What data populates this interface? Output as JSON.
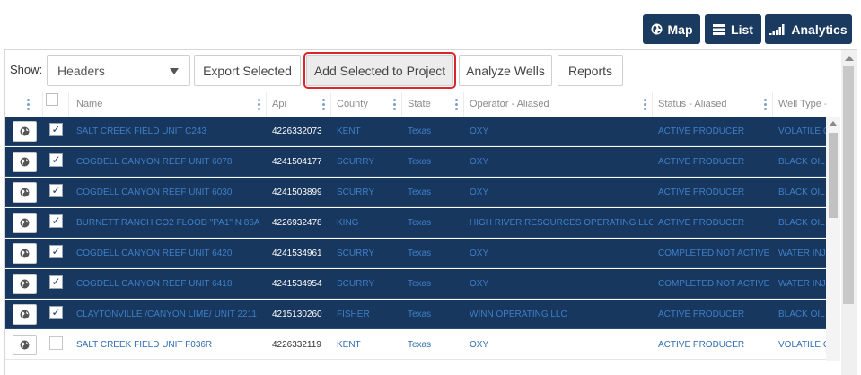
{
  "views": {
    "map": {
      "label": "Map",
      "icon": "globe-icon"
    },
    "list": {
      "label": "List",
      "icon": "list-icon"
    },
    "analytics": {
      "label": "Analytics",
      "icon": "bar-chart-icon"
    }
  },
  "toolbar": {
    "show_label": "Show:",
    "show_select_value": "Headers",
    "export_selected": "Export Selected",
    "add_selected_to_project": "Add Selected to Project",
    "analyze_wells": "Analyze Wells",
    "reports": "Reports"
  },
  "columns": {
    "name": "Name",
    "api": "Api",
    "county": "County",
    "state": "State",
    "operator": "Operator - Aliased",
    "status": "Status - Aliased",
    "well_type": "Well Type - Aliased"
  },
  "rows": [
    {
      "selected": true,
      "check": "✓",
      "name": "SALT CREEK FIELD UNIT C243",
      "api": "4226332073",
      "county": "KENT",
      "state": "Texas",
      "operator": "OXY",
      "status": "ACTIVE PRODUCER",
      "well_type": "VOLATILE OIL"
    },
    {
      "selected": true,
      "check": "✓",
      "name": "COGDELL CANYON REEF UNIT 6078",
      "api": "4241504177",
      "county": "SCURRY",
      "state": "Texas",
      "operator": "OXY",
      "status": "ACTIVE PRODUCER",
      "well_type": "BLACK OIL"
    },
    {
      "selected": true,
      "check": "✓",
      "name": "COGDELL CANYON REEF UNIT 6030",
      "api": "4241503899",
      "county": "SCURRY",
      "state": "Texas",
      "operator": "OXY",
      "status": "ACTIVE PRODUCER",
      "well_type": "BLACK OIL"
    },
    {
      "selected": true,
      "check": "✓",
      "name": "BURNETT RANCH CO2 FLOOD \"PA1\" N 86A",
      "api": "4226932478",
      "county": "KING",
      "state": "Texas",
      "operator": "HIGH RIVER RESOURCES OPERATING LLC",
      "status": "ACTIVE PRODUCER",
      "well_type": "BLACK OIL"
    },
    {
      "selected": true,
      "check": "✓",
      "name": "COGDELL CANYON REEF UNIT 6420",
      "api": "4241534961",
      "county": "SCURRY",
      "state": "Texas",
      "operator": "OXY",
      "status": "COMPLETED NOT ACTIVE",
      "well_type": "WATER INJECTOR"
    },
    {
      "selected": true,
      "check": "✓",
      "name": "COGDELL CANYON REEF UNIT 6418",
      "api": "4241534954",
      "county": "SCURRY",
      "state": "Texas",
      "operator": "OXY",
      "status": "COMPLETED NOT ACTIVE",
      "well_type": "WATER INJECTOR"
    },
    {
      "selected": true,
      "check": "✓",
      "name": "CLAYTONVILLE /CANYON LIME/ UNIT 2211",
      "api": "4215130260",
      "county": "FISHER",
      "state": "Texas",
      "operator": "WINN OPERATING LLC",
      "status": "ACTIVE PRODUCER",
      "well_type": "BLACK OIL"
    },
    {
      "selected": false,
      "check": "",
      "name": "SALT CREEK FIELD UNIT F036R",
      "api": "4226332119",
      "county": "KENT",
      "state": "Texas",
      "operator": "OXY",
      "status": "ACTIVE PRODUCER",
      "well_type": "VOLATILE OIL"
    }
  ],
  "colors": {
    "header_button_bg": "#1b3a5f",
    "selected_row_bg": "#17375e",
    "link_blue": "#3f7fc7",
    "highlight_outline": "#d9262c"
  }
}
